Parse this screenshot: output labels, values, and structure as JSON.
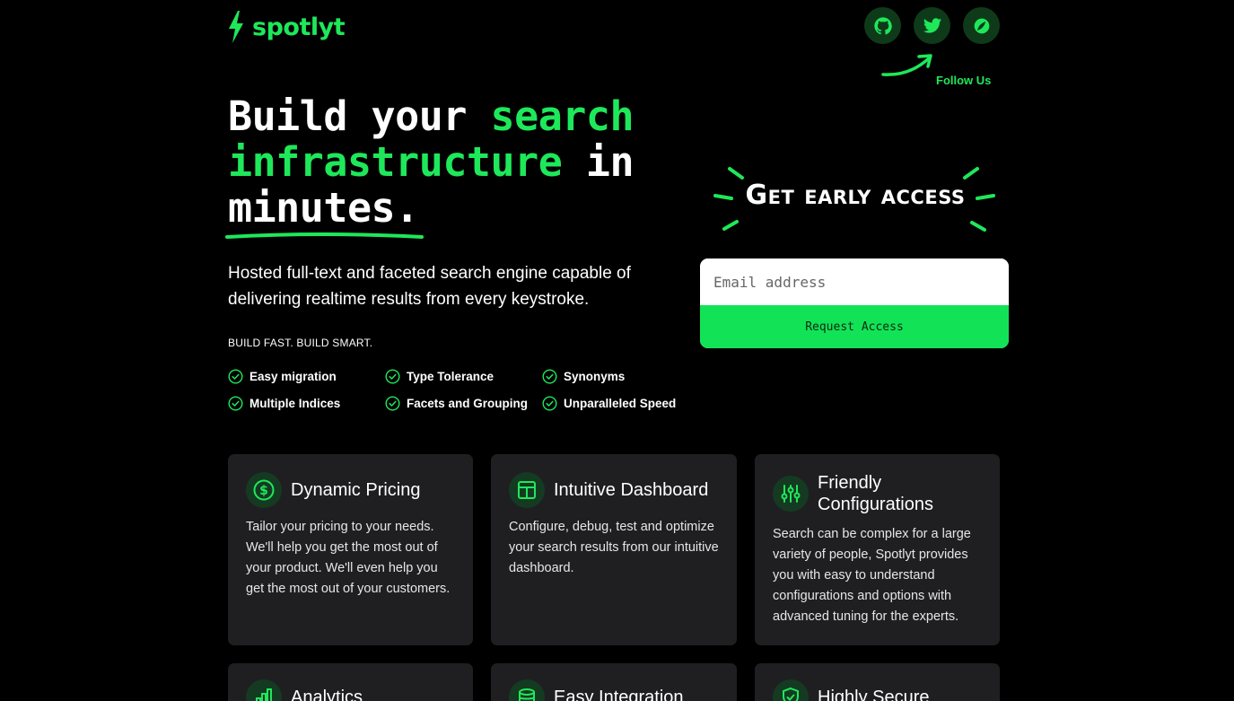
{
  "brand": {
    "name": "spotlyt",
    "accent": "#1ee85a"
  },
  "social": [
    {
      "name": "github-icon"
    },
    {
      "name": "twitter-icon"
    },
    {
      "name": "discord-icon"
    }
  ],
  "follow_label": "Follow Us",
  "hero": {
    "t1": "Build your ",
    "t2": "search",
    "t3": "infrastructure",
    "t4": " in",
    "t5": "minutes."
  },
  "subtitle": "Hosted full-text and faceted search engine capable of delivering realtime results from every keystroke.",
  "tagline": "BUILD FAST. BUILD SMART.",
  "features": [
    "Easy migration",
    "Type Tolerance",
    "Synonyms",
    "Multiple Indices",
    "Facets and Grouping",
    "Unparalleled Speed"
  ],
  "early_access": {
    "heading": "Get early access",
    "email_placeholder": "Email address",
    "button": "Request Access"
  },
  "cards": [
    {
      "title": "Dynamic Pricing",
      "body": "Tailor your pricing to your needs. We'll help you get the most out of your product. We'll even help you get the most out of your customers."
    },
    {
      "title": "Intuitive Dashboard",
      "body": "Configure, debug, test and optimize your search results from our intuitive dashboard."
    },
    {
      "title": "Friendly Configurations",
      "body": "Search can be complex for a large variety of people, Spotlyt provides you with easy to understand configurations and options with advanced tuning for the experts."
    },
    {
      "title": "Analytics",
      "body": ""
    },
    {
      "title": "Easy Integration",
      "body": ""
    },
    {
      "title": "Highly Secure",
      "body": ""
    }
  ]
}
